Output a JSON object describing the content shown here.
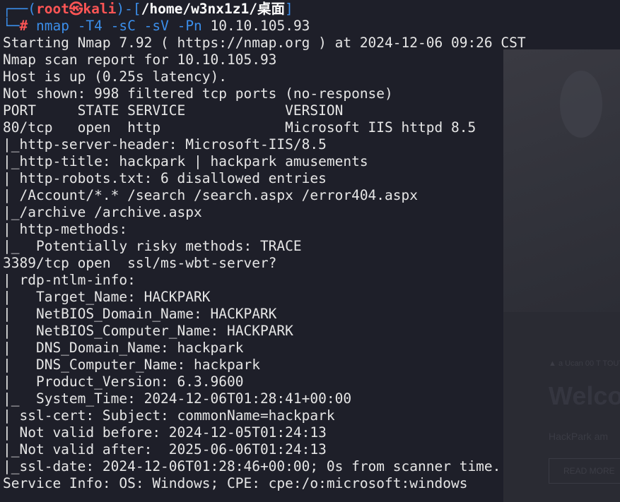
{
  "background_page": {
    "meta_text": "▲ a Ucan 00 T TOUT",
    "heading": "Welco",
    "intro": "HackPark am",
    "button_label": "READ MORE"
  },
  "prompt": {
    "box_top": "┌──(",
    "user_host": "root㉿kali",
    "separator": ")-[",
    "path": "/home/w3nx1z1/桌面",
    "path_close": "]",
    "box_bottom": "└─",
    "hash": "#",
    "command": "nmap",
    "args": " -T4 -sC -sV -Pn ",
    "target": "10.10.105.93"
  },
  "output_lines": [
    "Starting Nmap 7.92 ( https://nmap.org ) at 2024-12-06 09:26 CST",
    "Nmap scan report for 10.10.105.93",
    "Host is up (0.25s latency).",
    "Not shown: 998 filtered tcp ports (no-response)",
    "PORT     STATE SERVICE            VERSION",
    "80/tcp   open  http               Microsoft IIS httpd 8.5",
    "|_http-server-header: Microsoft-IIS/8.5",
    "|_http-title: hackpark | hackpark amusements",
    "| http-robots.txt: 6 disallowed entries",
    "| /Account/*.* /search /search.aspx /error404.aspx",
    "|_/archive /archive.aspx",
    "| http-methods:",
    "|_  Potentially risky methods: TRACE",
    "3389/tcp open  ssl/ms-wbt-server?",
    "| rdp-ntlm-info:",
    "|   Target_Name: HACKPARK",
    "|   NetBIOS_Domain_Name: HACKPARK",
    "|   NetBIOS_Computer_Name: HACKPARK",
    "|   DNS_Domain_Name: hackpark",
    "|   DNS_Computer_Name: hackpark",
    "|   Product_Version: 6.3.9600",
    "|_  System_Time: 2024-12-06T01:28:41+00:00",
    "| ssl-cert: Subject: commonName=hackpark",
    "| Not valid before: 2024-12-05T01:24:13",
    "|_Not valid after:  2025-06-06T01:24:13",
    "|_ssl-date: 2024-12-06T01:28:46+00:00; 0s from scanner time.",
    "Service Info: OS: Windows; CPE: cpe:/o:microsoft:windows"
  ],
  "colors": {
    "background": "#1e1f29",
    "prompt_blue": "#3b8eea",
    "prompt_red": "#ff5555",
    "text": "#e6e6e6"
  }
}
